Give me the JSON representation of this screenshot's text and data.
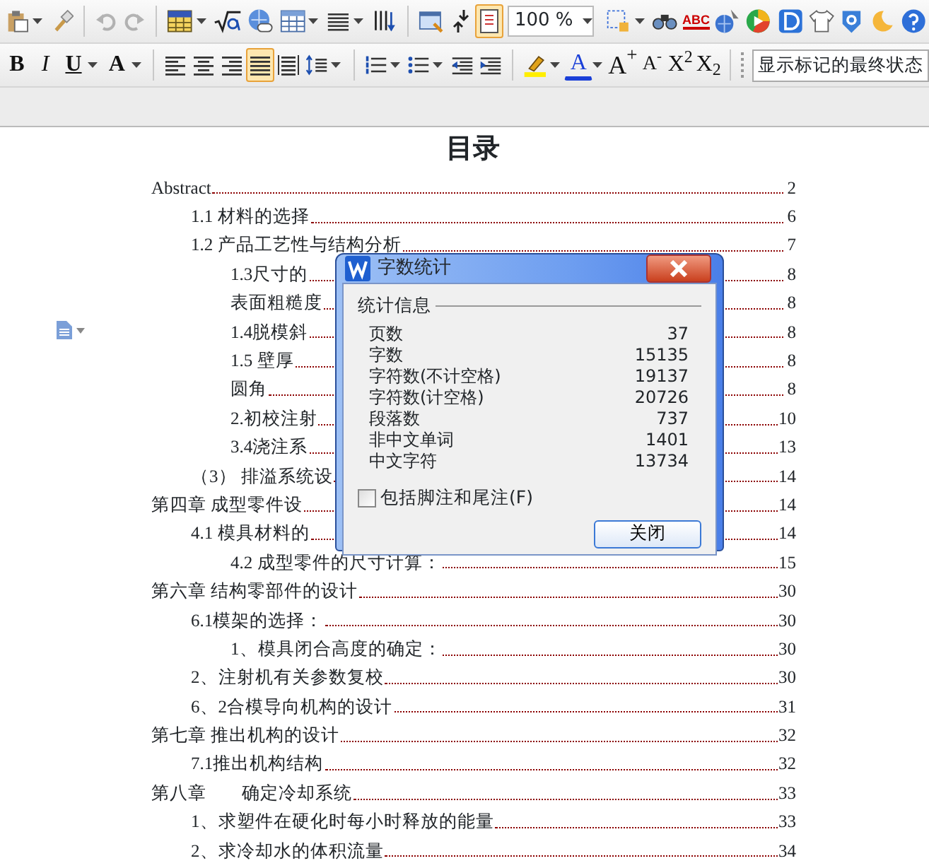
{
  "toolbar_1": {
    "buttons": [
      {
        "selected": false,
        "disabled": false,
        "dropdown": true
      },
      {
        "selected": false,
        "disabled": false,
        "dropdown": false
      },
      {
        "selected": false,
        "disabled": true,
        "dropdown": false
      },
      {
        "selected": false,
        "disabled": true,
        "dropdown": false
      },
      {
        "selected": false,
        "disabled": false,
        "dropdown": true
      },
      {
        "selected": false,
        "disabled": false,
        "dropdown": false
      },
      {
        "selected": false,
        "disabled": false,
        "dropdown": false
      },
      {
        "selected": false,
        "disabled": false,
        "dropdown": true
      },
      {
        "selected": false,
        "disabled": false,
        "dropdown": true
      },
      {
        "selected": false,
        "disabled": false,
        "dropdown": false
      },
      {
        "selected": false,
        "disabled": false,
        "dropdown": false
      },
      {
        "selected": false,
        "disabled": false,
        "dropdown": false
      },
      {
        "selected": true,
        "disabled": false,
        "dropdown": false
      },
      {
        "selected": false,
        "disabled": false,
        "dropdown": true
      },
      {
        "selected": false,
        "disabled": false,
        "dropdown": false
      },
      {
        "selected": false,
        "disabled": false,
        "dropdown": false
      },
      {
        "selected": false,
        "disabled": false,
        "dropdown": false
      },
      {
        "selected": false,
        "disabled": false,
        "dropdown": false
      },
      {
        "selected": false,
        "disabled": false,
        "dropdown": false
      },
      {
        "selected": false,
        "disabled": false,
        "dropdown": false
      },
      {
        "selected": false,
        "disabled": false,
        "dropdown": false
      },
      {
        "selected": false,
        "disabled": false,
        "dropdown": false
      },
      {
        "selected": false,
        "disabled": false,
        "dropdown": false
      }
    ],
    "zoom": "100 %",
    "spell_label": "ABC"
  },
  "toolbar_2": {
    "buttons": [
      {
        "label": "B",
        "selected": false,
        "dropdown": false
      },
      {
        "label": "I",
        "selected": false,
        "dropdown": false
      },
      {
        "label": "U",
        "selected": false,
        "dropdown": true
      },
      {
        "label": "A",
        "selected": false,
        "dropdown": true
      },
      {
        "selected": false,
        "dropdown": false
      },
      {
        "selected": false,
        "dropdown": false
      },
      {
        "selected": false,
        "dropdown": false
      },
      {
        "selected": true,
        "dropdown": false
      },
      {
        "selected": false,
        "dropdown": false
      },
      {
        "selected": false,
        "dropdown": true
      },
      {
        "selected": false,
        "dropdown": true
      },
      {
        "selected": false,
        "dropdown": true
      },
      {
        "selected": false,
        "dropdown": false
      },
      {
        "selected": false,
        "dropdown": false
      },
      {
        "selected": false,
        "dropdown": true
      },
      {
        "label": "A",
        "selected": false,
        "dropdown": true
      },
      {
        "label": "A$^{+}$",
        "selected": false,
        "dropdown": false
      },
      {
        "label": "A$^{-}$",
        "selected": false,
        "dropdown": false
      },
      {
        "label": "X$^{2}$",
        "selected": false,
        "dropdown": false
      },
      {
        "label": "X$_{2}$",
        "selected": false,
        "dropdown": false
      }
    ],
    "markup_mode": "显示标记的最终状态"
  },
  "document": {
    "title": "目录",
    "toc": [
      {
        "text": "Abstract",
        "page": "2",
        "children": [
          {
            "text": "1.1 材料的选择",
            "page": "6"
          },
          {
            "text": "1.2 产品工艺性与结构分析",
            "page": "7",
            "children": [
              {
                "text": "1.3尺寸的",
                "page": "8"
              },
              {
                "text": "表面粗糙度",
                "page": "8"
              },
              {
                "text": "1.4脱模斜",
                "page": "8"
              },
              {
                "text": "1.5 壁厚",
                "page": "8"
              },
              {
                "text": "圆角",
                "page": "8"
              },
              {
                "text": "2.初校注射",
                "page": "10"
              },
              {
                "text": "3.4浇注系",
                "page": "13"
              }
            ]
          },
          {
            "text": "（3） 排溢系统设",
            "page": "14"
          }
        ]
      },
      {
        "text": "第四章 成型零件设",
        "page": "14",
        "children": [
          {
            "text": "4.1 模具材料的",
            "page": "14",
            "children": [
              {
                "text": "4.2 成型零件的尺寸计算：",
                "page": "15"
              }
            ]
          }
        ]
      },
      {
        "text": "第六章 结构零部件的设计",
        "page": "30",
        "children": [
          {
            "text": "6.1模架的选择：",
            "page": "30",
            "children": [
              {
                "text": "1、模具闭合高度的确定：",
                "page": "30"
              }
            ]
          },
          {
            "text": "2、注射机有关参数复校",
            "page": "30"
          },
          {
            "text": "6、2合模导向机构的设计",
            "page": "31"
          }
        ]
      },
      {
        "text": "第七章 推出机构的设计",
        "page": "32",
        "children": [
          {
            "text": "7.1推出机构结构",
            "page": "32"
          }
        ]
      },
      {
        "text": "第八章        确定冷却系统",
        "page": "33",
        "children": [
          {
            "text": "1、求塑件在硬化时每小时释放的能量",
            "page": "33"
          },
          {
            "text": "2、求冷却水的体积流量",
            "page": "34"
          }
        ]
      }
    ]
  },
  "dialog": {
    "title": "字数统计",
    "section": "统计信息",
    "stats": [
      {
        "label": "页数",
        "value": "37"
      },
      {
        "label": "字数",
        "value": "15135"
      },
      {
        "label": "字符数(不计空格)",
        "value": "19137"
      },
      {
        "label": "字符数(计空格)",
        "value": "20726"
      },
      {
        "label": "段落数",
        "value": "737"
      },
      {
        "label": "非中文单词",
        "value": "1401"
      },
      {
        "label": "中文字符",
        "value": "13734"
      }
    ],
    "checkbox": {
      "label": "包括脚注和尾注(F)",
      "checked": false
    },
    "button": "关闭"
  }
}
